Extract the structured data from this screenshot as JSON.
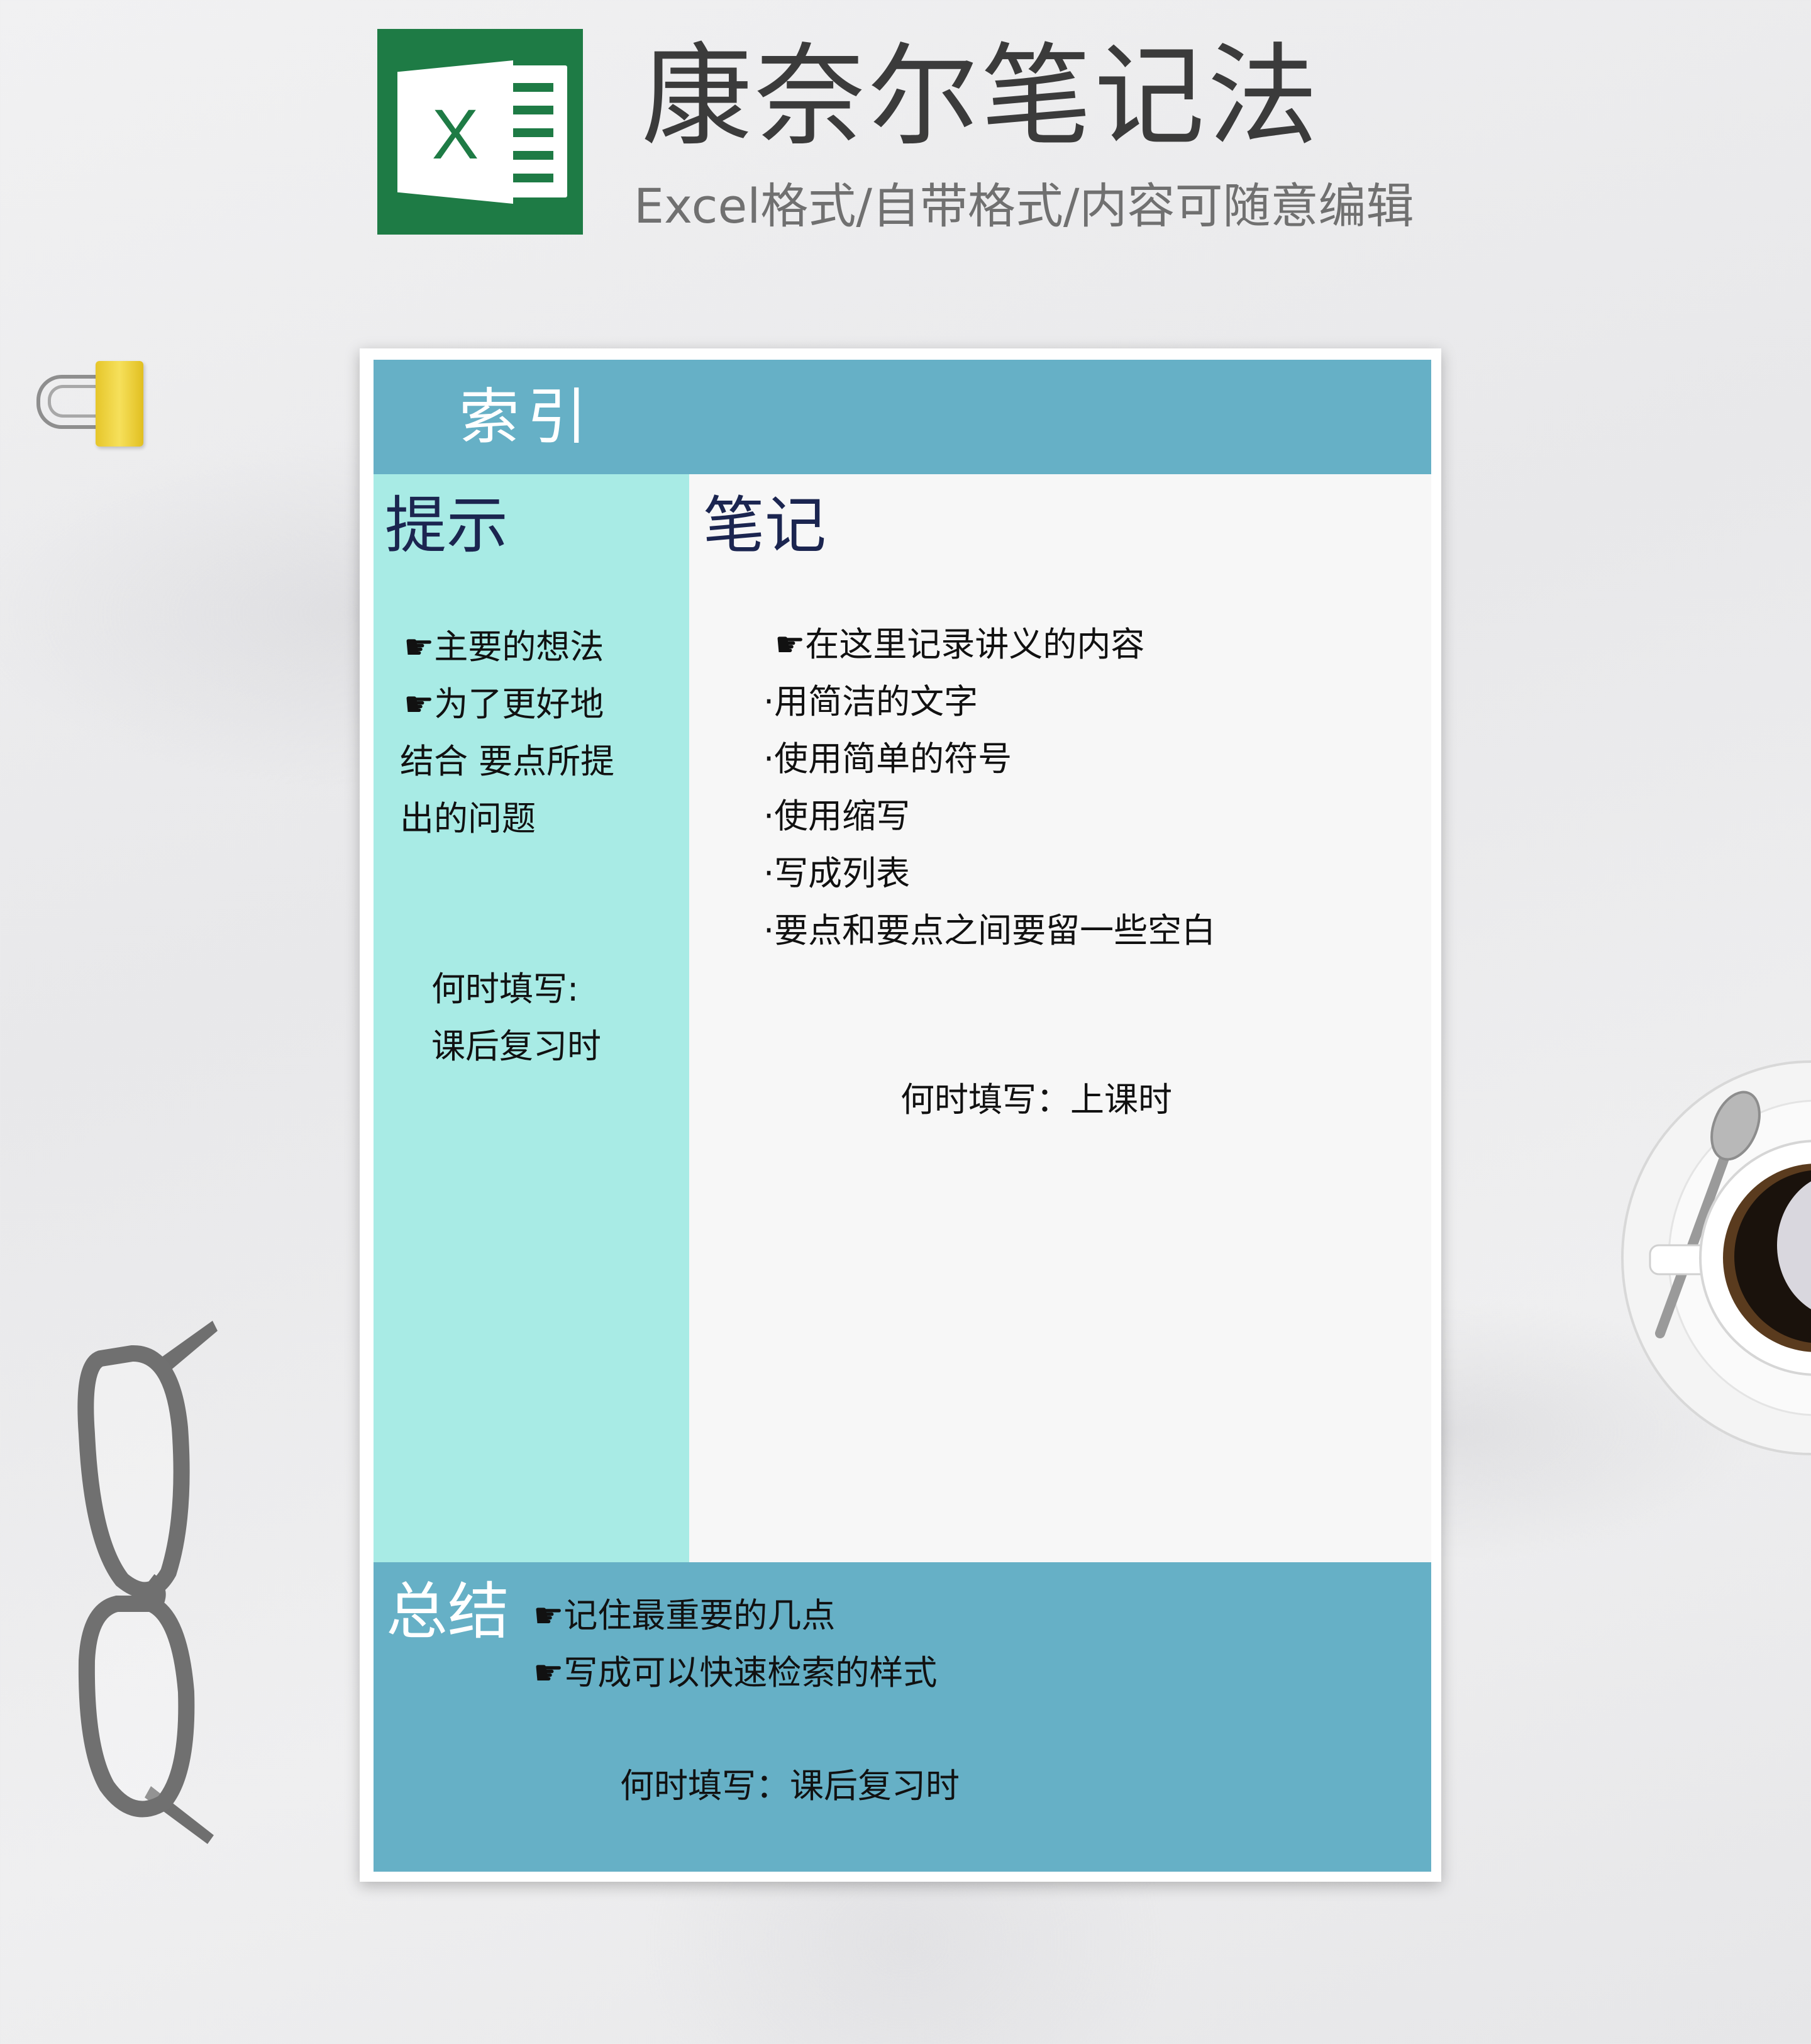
{
  "header": {
    "title": "康奈尔笔记法",
    "subtitle": "Excel格式/自带格式/内容可随意编辑",
    "logo_letter": "X",
    "logo_color": "#1e7b45"
  },
  "sheet": {
    "index_label": "索引",
    "cue": {
      "heading": "提示",
      "lines": [
        "☛主要的想法",
        "☛为了更好地",
        "结合 要点所提",
        "出的问题"
      ],
      "when_lines": [
        "何时填写:",
        "课后复习时"
      ]
    },
    "notes": {
      "heading": "笔记",
      "lines": [
        "☛在这里记录讲义的内容",
        "·用简洁的文字",
        "·使用简单的符号",
        "·使用缩写",
        "·写成列表",
        "·要点和要点之间要留一些空白"
      ],
      "when": "何时填写：上课时"
    },
    "summary": {
      "heading": "总结",
      "lines": [
        "☛记住最重要的几点",
        "☛写成可以快速检索的样式"
      ],
      "when": "何时填写：课后复习时"
    },
    "colors": {
      "band": "#66b0c6",
      "cue_bg": "#a8ebe5",
      "notes_bg": "#f7f7f7",
      "heading": "#1b2550"
    }
  },
  "decor": {
    "clip_icon": "binder-clip-icon",
    "glasses_icon": "eyeglasses-icon",
    "cup_icon": "coffee-cup-icon"
  }
}
